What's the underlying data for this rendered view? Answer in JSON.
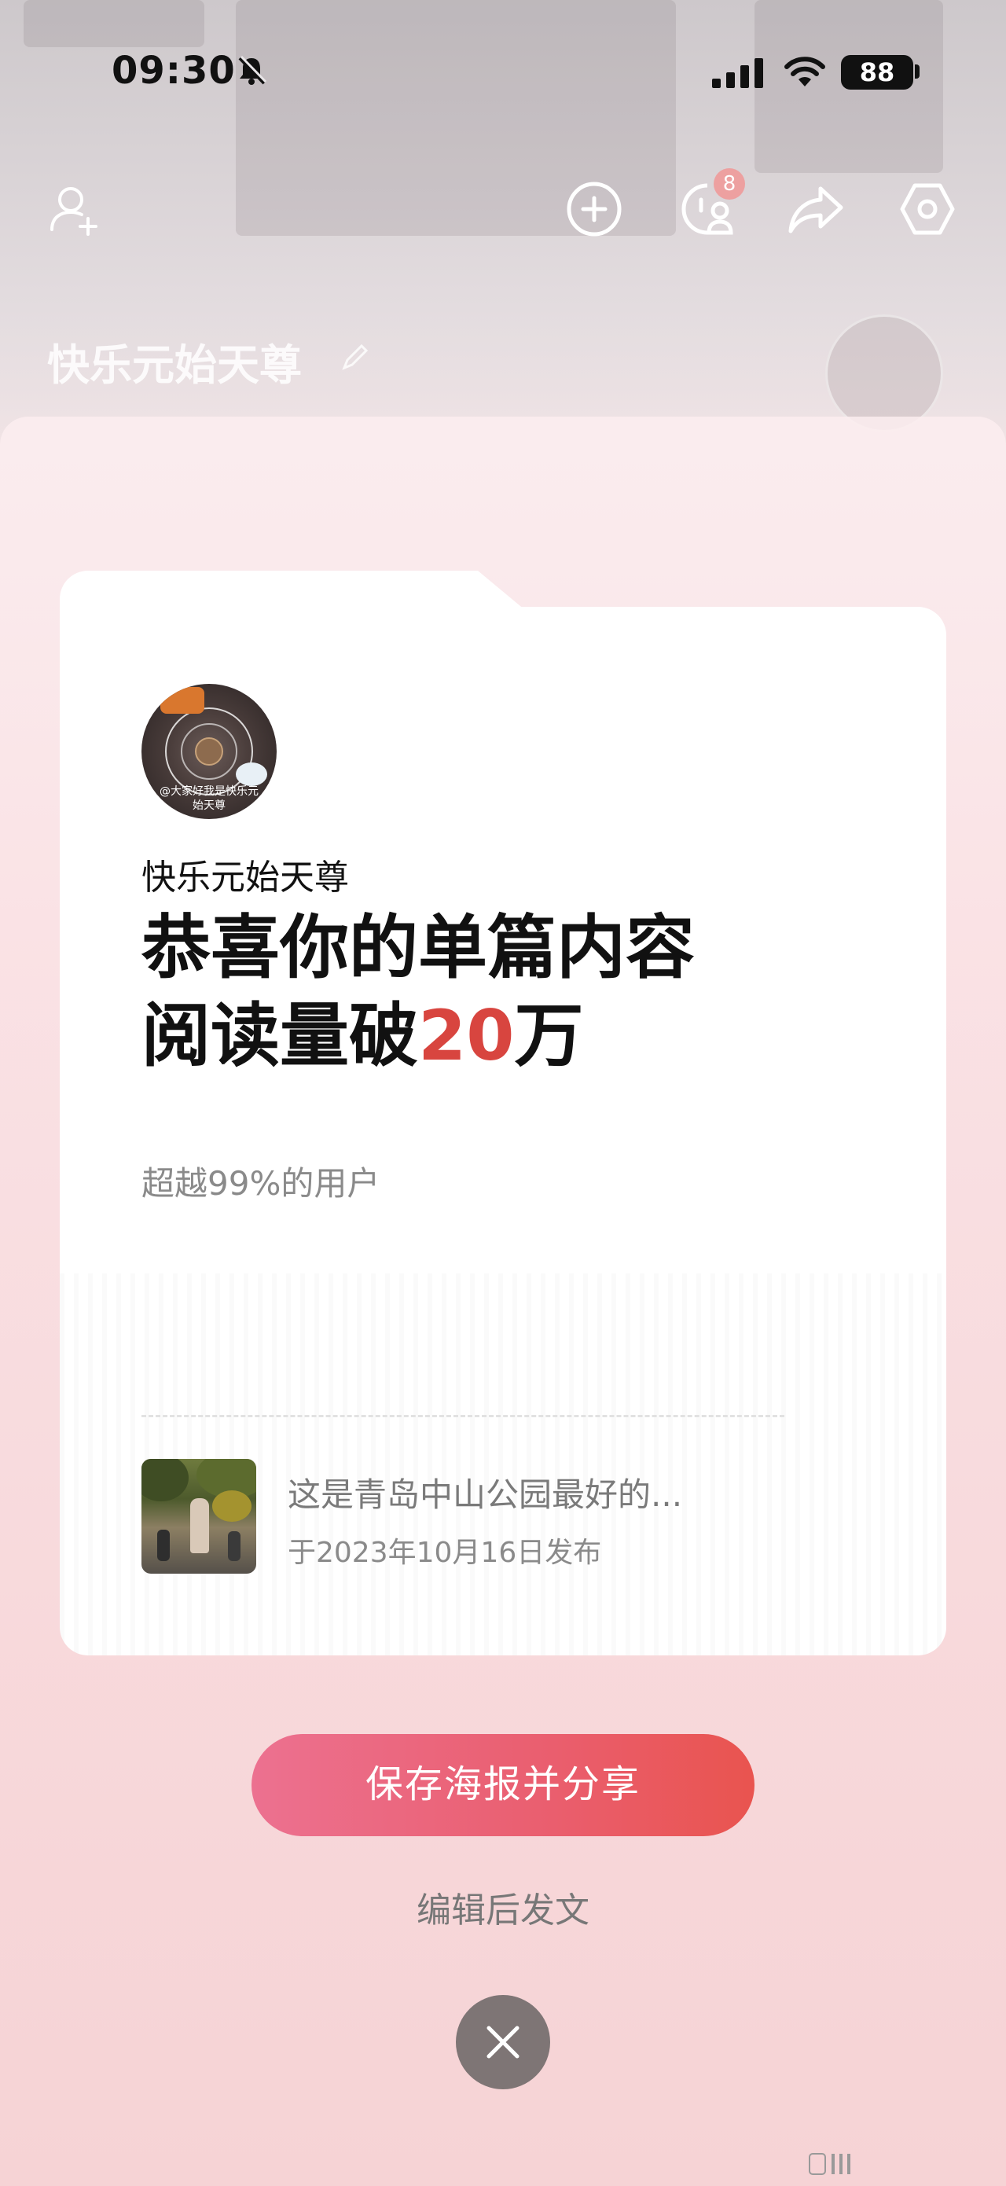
{
  "status_bar": {
    "time": "09:30",
    "battery": "88"
  },
  "top_nav": {
    "notification_badge": "8"
  },
  "background_profile": {
    "name": "快乐元始天尊"
  },
  "card": {
    "avatar_caption": "@大家好我是快乐元始天尊",
    "user_name": "快乐元始天尊",
    "headline_line1": "恭喜你的单篇内容",
    "headline_line2_prefix": "阅读量破",
    "headline_number": "20",
    "headline_line2_suffix": "万",
    "subtitle": "超越99%的用户",
    "post": {
      "title": "这是青岛中山公园最好的...",
      "date": "于2023年10月16日发布"
    }
  },
  "actions": {
    "save_share": "保存海报并分享",
    "edit_post": "编辑后发文"
  },
  "colors": {
    "accent": "#d8453f",
    "button_start": "#ec7190",
    "button_end": "#e9544f"
  }
}
